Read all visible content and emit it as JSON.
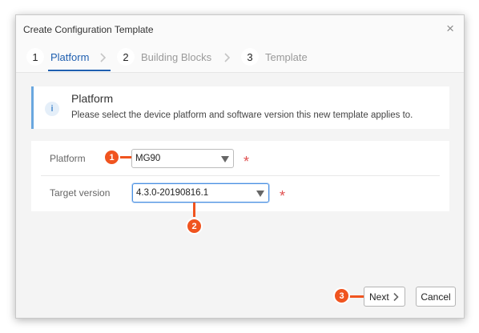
{
  "dialog": {
    "title": "Create Configuration Template",
    "close_glyph": "×"
  },
  "steps": [
    {
      "number": "1",
      "label": "Platform",
      "active": true
    },
    {
      "number": "2",
      "label": "Building Blocks",
      "active": false
    },
    {
      "number": "3",
      "label": "Template",
      "active": false
    }
  ],
  "info": {
    "icon": "info-icon",
    "icon_glyph": "i",
    "title": "Platform",
    "text": "Please select the device platform and software version this new template applies to."
  },
  "form": {
    "platform": {
      "label": "Platform",
      "value": "MG90",
      "required_mark": "*"
    },
    "target_version": {
      "label": "Target version",
      "value": "4.3.0-20190816.1",
      "required_mark": "*"
    }
  },
  "buttons": {
    "next": "Next",
    "cancel": "Cancel"
  },
  "callouts": [
    "1",
    "2",
    "3"
  ],
  "colors": {
    "accent": "#1f5fb0",
    "callout": "#f0541f",
    "required": "#e05050",
    "info_bar": "#6aa7df"
  }
}
